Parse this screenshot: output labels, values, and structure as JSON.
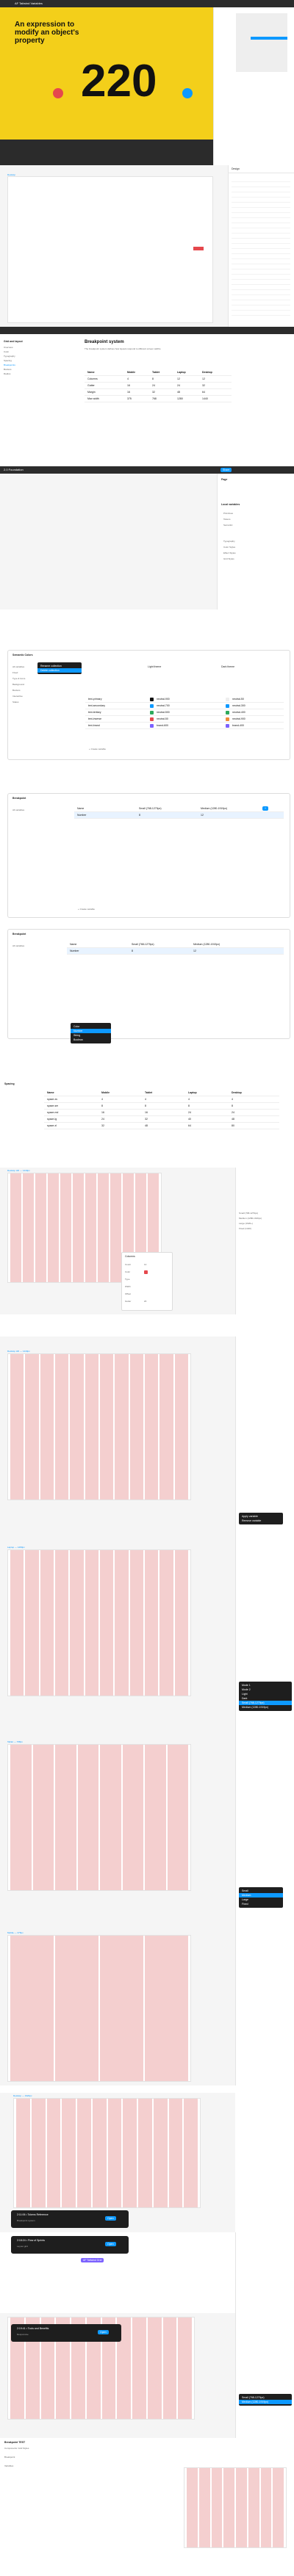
{
  "video": {
    "headline": "An expression to modify an object's property",
    "big_number": "220",
    "tab_title": "AF Tailwind Variables"
  },
  "section2": {
    "frame_label": "Desktop",
    "props_title": "Design"
  },
  "doc": {
    "title": "Breakpoint system",
    "sidebar_title": "Grid and layout",
    "sidebar_items": [
      "Overview",
      "Color",
      "Typography",
      "Spacing",
      "Breakpoints",
      "Borders",
      "Radius"
    ],
    "body_text": "The breakpoint system defines how layouts respond to different screen widths.",
    "table_headers": [
      "Name",
      "Mobile",
      "Tablet",
      "Laptop",
      "Desktop"
    ],
    "table_rows": [
      [
        "Columns",
        "4",
        "8",
        "12",
        "12"
      ],
      [
        "Gutter",
        "16",
        "24",
        "24",
        "32"
      ],
      [
        "Margin",
        "16",
        "32",
        "48",
        "64"
      ],
      [
        "Max width",
        "375",
        "768",
        "1280",
        "1440"
      ]
    ]
  },
  "local_vars": {
    "header_title": "2.0 Foundation",
    "share": "Share",
    "panel_title": "Page",
    "variables_header": "Local variables",
    "collections": [
      "Primitives",
      "Tokens",
      "Semantic"
    ],
    "styles": [
      "Typography",
      "Color Styles",
      "Effect Styles",
      "Grid Styles"
    ]
  },
  "semantic_modal": {
    "title": "Semantic Colors",
    "modes": [
      "Light theme",
      "Dark theme"
    ],
    "groups": [
      "All variables",
      "Fixed",
      "Type & Icons",
      "Background",
      "Borders",
      "Interactive",
      "Status"
    ],
    "menu": [
      "Rename collection",
      "Delete collection"
    ],
    "rows": [
      [
        "text-primary",
        "neutral-900",
        "neutral-50"
      ],
      [
        "text-secondary",
        "neutral-700",
        "neutral-300"
      ],
      [
        "text-tertiary",
        "neutral-500",
        "neutral-400"
      ],
      [
        "text-inverse",
        "neutral-50",
        "neutral-900"
      ],
      [
        "text-brand",
        "brand-600",
        "brand-400"
      ]
    ],
    "create": "+ Create variable"
  },
  "breakpoint_modal": {
    "title": "Breakpoint",
    "group": "All variables",
    "col_headers": [
      "Name",
      "Small (768-1279px)",
      "Medium (1280-1919px)"
    ],
    "row": [
      "Number",
      "8",
      "12"
    ],
    "create": "+ Create variable"
  },
  "breakpoint_modal2": {
    "title": "Breakpoint",
    "group": "All variables",
    "col_headers": [
      "Name",
      "Small (768-1279px)",
      "Medium (1280-1919px)"
    ],
    "row": [
      "Number",
      "8",
      "12"
    ],
    "type_menu": [
      "Color",
      "Number",
      "String",
      "Boolean"
    ]
  },
  "spacing_table": {
    "title": "Spacing",
    "headers": [
      "Name",
      "Mobile",
      "Tablet",
      "Laptop",
      "Desktop"
    ],
    "rows": [
      [
        "space-xs",
        "4",
        "4",
        "4",
        "4"
      ],
      [
        "space-sm",
        "8",
        "8",
        "8",
        "8"
      ],
      [
        "space-md",
        "16",
        "16",
        "24",
        "24"
      ],
      [
        "space-lg",
        "24",
        "32",
        "40",
        "48"
      ],
      [
        "space-xl",
        "32",
        "48",
        "64",
        "80"
      ]
    ]
  },
  "layout_grid": {
    "frame_label": "Desktop HD — 1440px",
    "popover_title": "Columns",
    "popover_items": [
      "Count",
      "Color",
      "Type",
      "Width",
      "Offset",
      "Gutter"
    ],
    "count_value": "12",
    "gutter_value": "20",
    "apply_menu": [
      "Apply variable",
      "Remove variable"
    ],
    "size_menu": [
      "Small",
      "Medium",
      "Large",
      "Fixed"
    ],
    "variable_list": [
      "Small (768-1279px)",
      "Medium (1280-1919px)",
      "Large (1920+)",
      "Fixed (1440)"
    ]
  },
  "frames": [
    "Desktop HD — 1440px",
    "Laptop — 1280px",
    "Tablet — 768px",
    "Mobile — 375px",
    "Desktop — 1920px",
    "Desktop — 1440px"
  ],
  "dark_banners": [
    {
      "title": "2:11:06 • Tokens Reference",
      "button": "Open",
      "sub": "Breakpoint system"
    },
    {
      "title": "2:18:24 • Flow of Sprints",
      "button": "Open",
      "sub": "Layout grid"
    },
    {
      "title": "2:19:41 • Tools and Benefits",
      "button": "Open",
      "sub": "Responsive"
    }
  ],
  "purple_tag": "AF Tailwind Grid",
  "modes_menu": [
    "Mode 1",
    "Mode 2",
    "Light",
    "Dark",
    "Small (768-1279px)",
    "Medium (1280-1919px)"
  ],
  "bottom": {
    "title": "Breakpoint TEST",
    "sub": "Components: Grid Styles",
    "breakpoints_label": "Breakpoint",
    "folder": "Variables"
  },
  "colors": {
    "accent": "#0d99ff",
    "grid_pink": "#f4cfcf",
    "toolbar": "#2c2c2c",
    "danger": "#e5484d",
    "purple": "#7b61ff"
  }
}
